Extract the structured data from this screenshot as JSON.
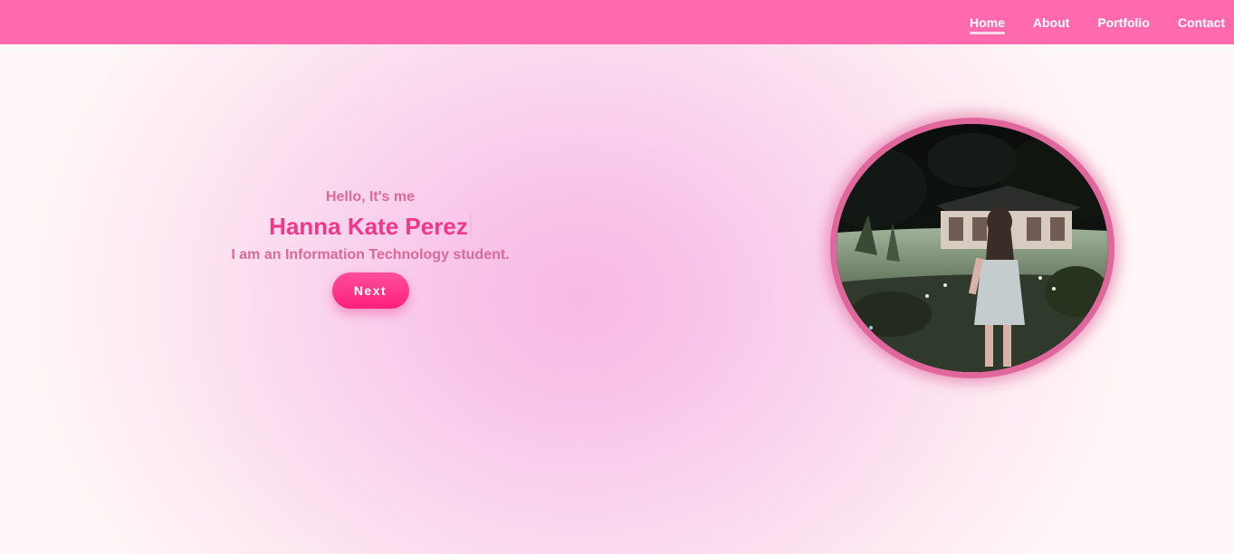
{
  "nav": {
    "items": [
      {
        "label": "Home",
        "active": true
      },
      {
        "label": "About",
        "active": false
      },
      {
        "label": "Portfolio",
        "active": false
      },
      {
        "label": "Contact",
        "active": false
      }
    ]
  },
  "hero": {
    "greeting": "Hello, It's me",
    "name": "Hanna Kate Perez",
    "tagline": "I am an Information Technology student.",
    "button_label": "Next"
  },
  "colors": {
    "navbar": "#ff6aae",
    "accent": "#f0388b",
    "button": "#ff2f86",
    "ring": "#e0679b"
  },
  "photo": {
    "description_icon": "profile-photo"
  }
}
